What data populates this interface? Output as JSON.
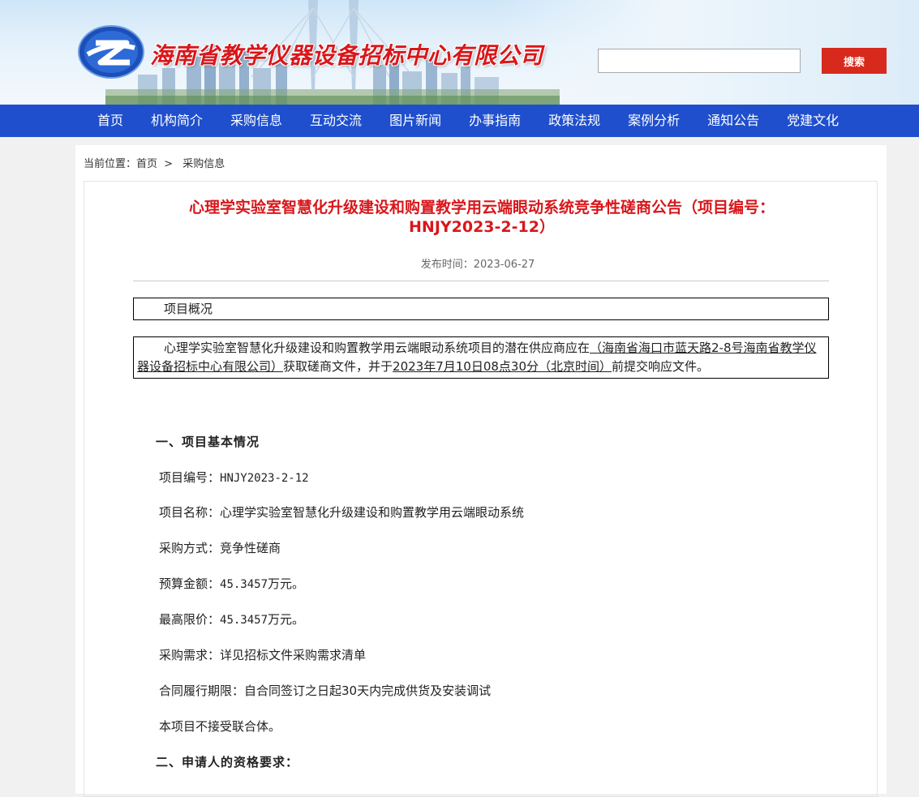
{
  "header": {
    "site_title": "海南省教学仪器设备招标中心有限公司",
    "search_placeholder": "",
    "search_label": "搜索"
  },
  "nav": {
    "items": [
      "首页",
      "机构简介",
      "采购信息",
      "互动交流",
      "图片新闻",
      "办事指南",
      "政策法规",
      "案例分析",
      "通知公告",
      "党建文化"
    ]
  },
  "breadcrumb": {
    "prefix": "当前位置：",
    "home": "首页",
    "sep": ">",
    "current": "采购信息"
  },
  "article": {
    "title_line1": "心理学实验室智慧化升级建设和购置教学用云端眼动系统竞争性磋商公告（项目编号：",
    "title_line2": "HNJY2023-2-12）",
    "date_label": "发布时间：",
    "date": "2023-06-27",
    "overview_heading": "项目概况",
    "overview_text_1": "心理学实验室智慧化升级建设和购置教学用云端眼动系统项目的潜在供应商应在",
    "overview_location": "（海南省海口市蓝天路2-8号海南省教学仪器设备招标中心有限公司）",
    "overview_text_2": "获取磋商文件，并于",
    "overview_deadline": "2023年7月10日08点30分（北京时间）",
    "overview_text_3": "前提交响应文件。",
    "section1_heading": "一、项目基本情况",
    "project_no_label": "项目编号：",
    "project_no": "HNJY2023-2-12",
    "project_name_label": "项目名称：",
    "project_name": "心理学实验室智慧化升级建设和购置教学用云端眼动系统",
    "method_label": "采购方式：",
    "method": "竞争性磋商",
    "budget_label": "预算金额：",
    "budget_value": "45.3457",
    "budget_unit": "万元。",
    "max_price_label": "最高限价：",
    "max_price_value": "45.3457",
    "max_price_unit": "万元。",
    "requirement_label": "采购需求：",
    "requirement": "详见招标文件采购需求清单",
    "period_label": "合同履行期限：",
    "period": "自合同签订之日起30天内完成供货及安装调试",
    "consortium": "本项目不接受联合体。",
    "section2_heading": "二、申请人的资格要求："
  }
}
